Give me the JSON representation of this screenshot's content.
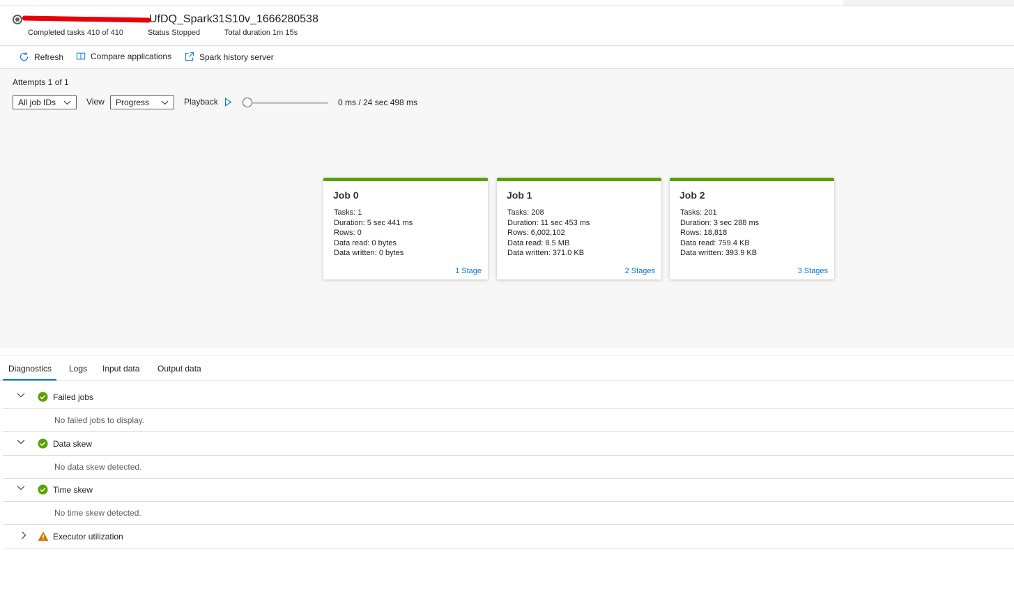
{
  "header": {
    "app_title_visible": "UfDQ_Spark31S10v_1666280538",
    "completed_tasks_label": "Completed tasks",
    "completed_tasks_value": "410 of 410",
    "status_label": "Status",
    "status_value": "Stopped",
    "total_duration_label": "Total duration",
    "total_duration_value": "1m 15s"
  },
  "commands": {
    "refresh": "Refresh",
    "compare": "Compare applications",
    "history": "Spark history server"
  },
  "graph": {
    "attempts": "Attempts 1 of 1",
    "job_filter": "All job IDs",
    "view_label": "View",
    "view_value": "Progress",
    "playback_label": "Playback",
    "playback_position_fraction": 0,
    "playback_time": "0 ms / 24 sec 498 ms"
  },
  "jobs": [
    {
      "title": "Job 0",
      "tasks": "1",
      "duration": "5 sec 441 ms",
      "rows": "0",
      "data_read": "0 bytes",
      "data_written": "0 bytes",
      "stages": "1 Stage"
    },
    {
      "title": "Job 1",
      "tasks": "208",
      "duration": "11 sec 453 ms",
      "rows": "6,002,102",
      "data_read": "8.5 MB",
      "data_written": "371.0 KB",
      "stages": "2 Stages"
    },
    {
      "title": "Job 2",
      "tasks": "201",
      "duration": "3 sec 288 ms",
      "rows": "18,818",
      "data_read": "759.4 KB",
      "data_written": "393.9 KB",
      "stages": "3 Stages"
    }
  ],
  "job_labels": {
    "tasks": "Tasks:",
    "duration": "Duration:",
    "rows": "Rows:",
    "data_read": "Data read:",
    "data_written": "Data written:"
  },
  "tabs": [
    "Diagnostics",
    "Logs",
    "Input data",
    "Output data"
  ],
  "diagnostics": {
    "failed_jobs": {
      "title": "Failed jobs",
      "message": "No failed jobs to display."
    },
    "data_skew": {
      "title": "Data skew",
      "message": "No data skew detected."
    },
    "time_skew": {
      "title": "Time skew",
      "message": "No time skew detected."
    },
    "executor": {
      "title": "Executor utilization"
    }
  },
  "colors": {
    "accent": "#0078d4",
    "success": "#57a300",
    "warning": "#d47500",
    "redaction": "#e8000b"
  }
}
